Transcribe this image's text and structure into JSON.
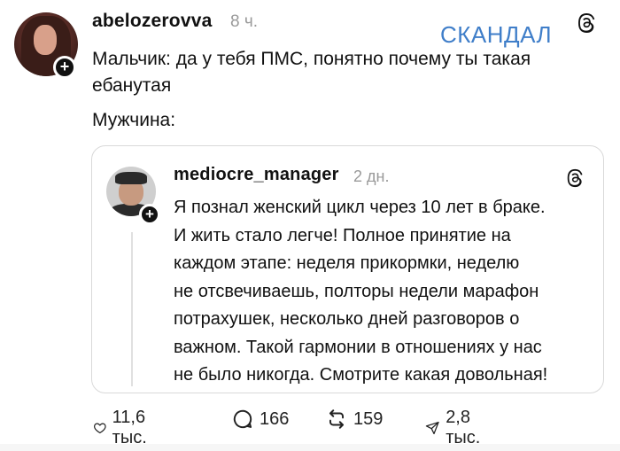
{
  "watermark": "СКАНДАЛ",
  "post": {
    "username": "abelozerovva",
    "time": "8 ч.",
    "lines": [
      "Мальчик: да у тебя ПМС, понятно почему ты такая",
      "ебанутая",
      "Мужчина:"
    ]
  },
  "quote": {
    "username": "mediocre_manager",
    "time": "2 дн.",
    "lines": [
      "Я познал женский цикл через 10 лет в браке.",
      "И жить стало легче! Полное принятие на",
      "каждом этапе: неделя прикормки, неделю",
      "не отсвечиваешь, полторы недели марафон",
      "потрахушек, несколько дней разговоров о",
      "важном. Такой гармонии в отношениях у нас",
      "не было никогда. Смотрите какая довольная!"
    ]
  },
  "actions": {
    "likes": "11,6 тыс.",
    "replies": "166",
    "reposts": "159",
    "shares": "2,8 тыс."
  },
  "icons": {
    "like": "heart-icon",
    "reply": "comment-icon",
    "repost": "repost-icon",
    "share": "share-icon",
    "threads": "threads-logo-icon",
    "plus": "plus-icon"
  }
}
